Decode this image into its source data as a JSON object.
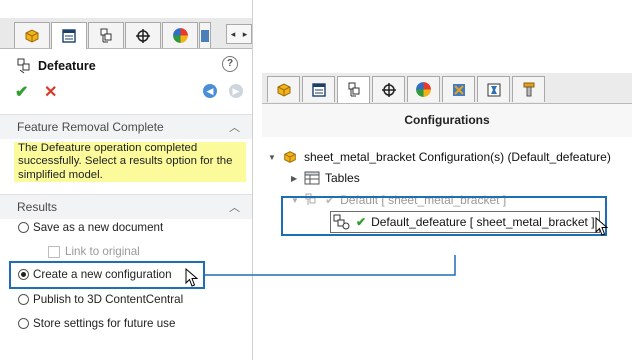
{
  "left_panel": {
    "title": "Defeature",
    "help_icon": "?",
    "ok_icon": "✔",
    "cancel_icon": "✕",
    "back_icon": "◀",
    "forward_icon": "▶",
    "tab_scroll_left": "◂",
    "tab_scroll_right": "▸",
    "tabs": [
      {
        "icon": "part-icon"
      },
      {
        "icon": "property-manager-icon"
      },
      {
        "icon": "configuration-manager-icon"
      },
      {
        "icon": "dimxpert-icon"
      },
      {
        "icon": "display-manager-icon"
      }
    ],
    "feature_removal": {
      "heading": "Feature Removal Complete",
      "message": "The Defeature operation completed successfully. Select a results option for the simplified model."
    },
    "results": {
      "heading": "Results",
      "options": [
        {
          "label": "Save as a new document",
          "selected": false
        },
        {
          "label": "Create a new configuration",
          "selected": true
        },
        {
          "label": "Publish to 3D ContentCentral",
          "selected": false
        },
        {
          "label": "Store settings for future use",
          "selected": false
        }
      ],
      "link_checkbox": {
        "label": "Link to original",
        "checked": false,
        "enabled": false
      }
    },
    "highlight_color": "#1e6eb6",
    "message_bg": "#fbfb9c"
  },
  "right_panel": {
    "header": "Configurations",
    "tabs": [
      {
        "icon": "part-icon"
      },
      {
        "icon": "property-manager-icon"
      },
      {
        "icon": "configuration-manager-icon"
      },
      {
        "icon": "dimxpert-icon"
      },
      {
        "icon": "display-manager-icon"
      },
      {
        "icon": "cam-icon"
      },
      {
        "icon": "simulation-icon"
      },
      {
        "icon": "toolpath-icon"
      }
    ],
    "tree": {
      "root": "sheet_metal_bracket Configuration(s)  (Default_defeature)",
      "tables": "Tables",
      "default_config": "Default [ sheet_metal_bracket ]",
      "defeature_config": "Default_defeature [ sheet_metal_bracket ]"
    }
  }
}
